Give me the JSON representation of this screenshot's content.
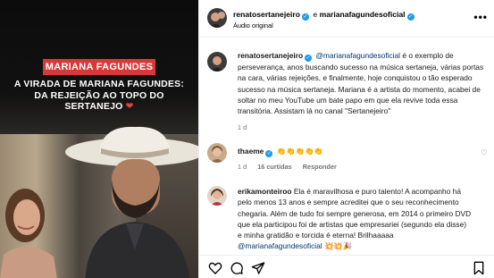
{
  "media": {
    "badge": "MARIANA FAGUNDES",
    "headline_line1": "A VIRADA DE MARIANA FAGUNDES:",
    "headline_line2": "DA REJEIÇÃO AO TOPO DO",
    "headline_line3": "SERTANEJO",
    "headline_heart": "❤"
  },
  "header": {
    "user1": "renatosertanejeiro",
    "conjunction": "e",
    "user2": "marianafagundesoficial",
    "subtitle": "Áudio original",
    "more": "•••"
  },
  "caption": {
    "user": "renatosertanejeiro",
    "mention": "@marianafagundesoficial",
    "text": " é o exemplo de perseverança, anos buscando sucesso na música sertaneja, várias portas na cara, várias rejeições, e finalmente, hoje conquistou o tão esperado sucesso na música sertaneja. Mariana é a artista do momento, acabei de soltar no meu YouTube um bate papo em que ela revive toda essa transitória. Assistam lá no canal \"Sertanejeiro\"",
    "time": "1 d"
  },
  "comments": [
    {
      "user": "thaeme",
      "text": "👏👏👏👏👏",
      "time": "1 d",
      "likes": "16 curtidas",
      "reply": "Responder"
    },
    {
      "user": "erikamonteiroo",
      "text": "Ela é maravilhosa e puro talento! A acompanho há pelo menos 13 anos e sempre acreditei que o seu reconhecimento chegaria. Além de tudo foi sempre generosa, em 2014 o primeiro DVD que ela participou foi de artistas que empresariei (segundo ela disse) e minha gratidão e torcida é eterna! Brilhaaaaa ",
      "mention": "@marianafagundesoficial",
      "emojis": " 💥💥🎉"
    }
  ],
  "actions": {
    "like_icon": "heart-icon",
    "comment_icon": "comment-icon",
    "share_icon": "share-icon",
    "save_icon": "bookmark-icon"
  }
}
